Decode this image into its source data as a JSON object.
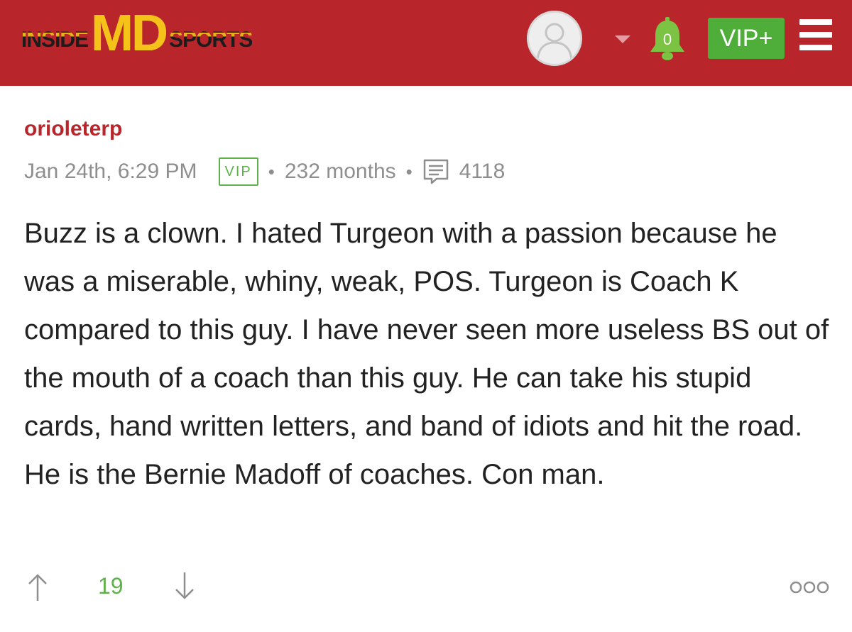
{
  "header": {
    "logo": {
      "left": "INSIDE",
      "center": "MD",
      "right": "SPORTS"
    },
    "notification_count": "0",
    "vip_button_label": "VIP+",
    "colors": {
      "bar": "#b8262b",
      "logo_yellow": "#f5c21a",
      "vip_green": "#4fae3a"
    }
  },
  "post": {
    "username": "orioleterp",
    "timestamp": "Jan 24th, 6:29 PM",
    "badge": "VIP",
    "membership": "232 months",
    "post_count": "4118",
    "body": "Buzz is a clown. I hated Turgeon with a passion because he was a miserable, whiny, weak, POS. Turgeon is Coach K compared to this guy. I have never seen more useless BS out of the mouth of a coach than this guy. He can take his stupid cards, hand written letters, and band of idiots and hit the road. He is the Bernie Madoff of coaches. Con man.",
    "score": "19",
    "separator": "•",
    "icons": {
      "upvote": "arrow-up-icon",
      "downvote": "arrow-down-icon",
      "comments": "comment-bubble-icon",
      "more": "more-options-icon"
    }
  }
}
